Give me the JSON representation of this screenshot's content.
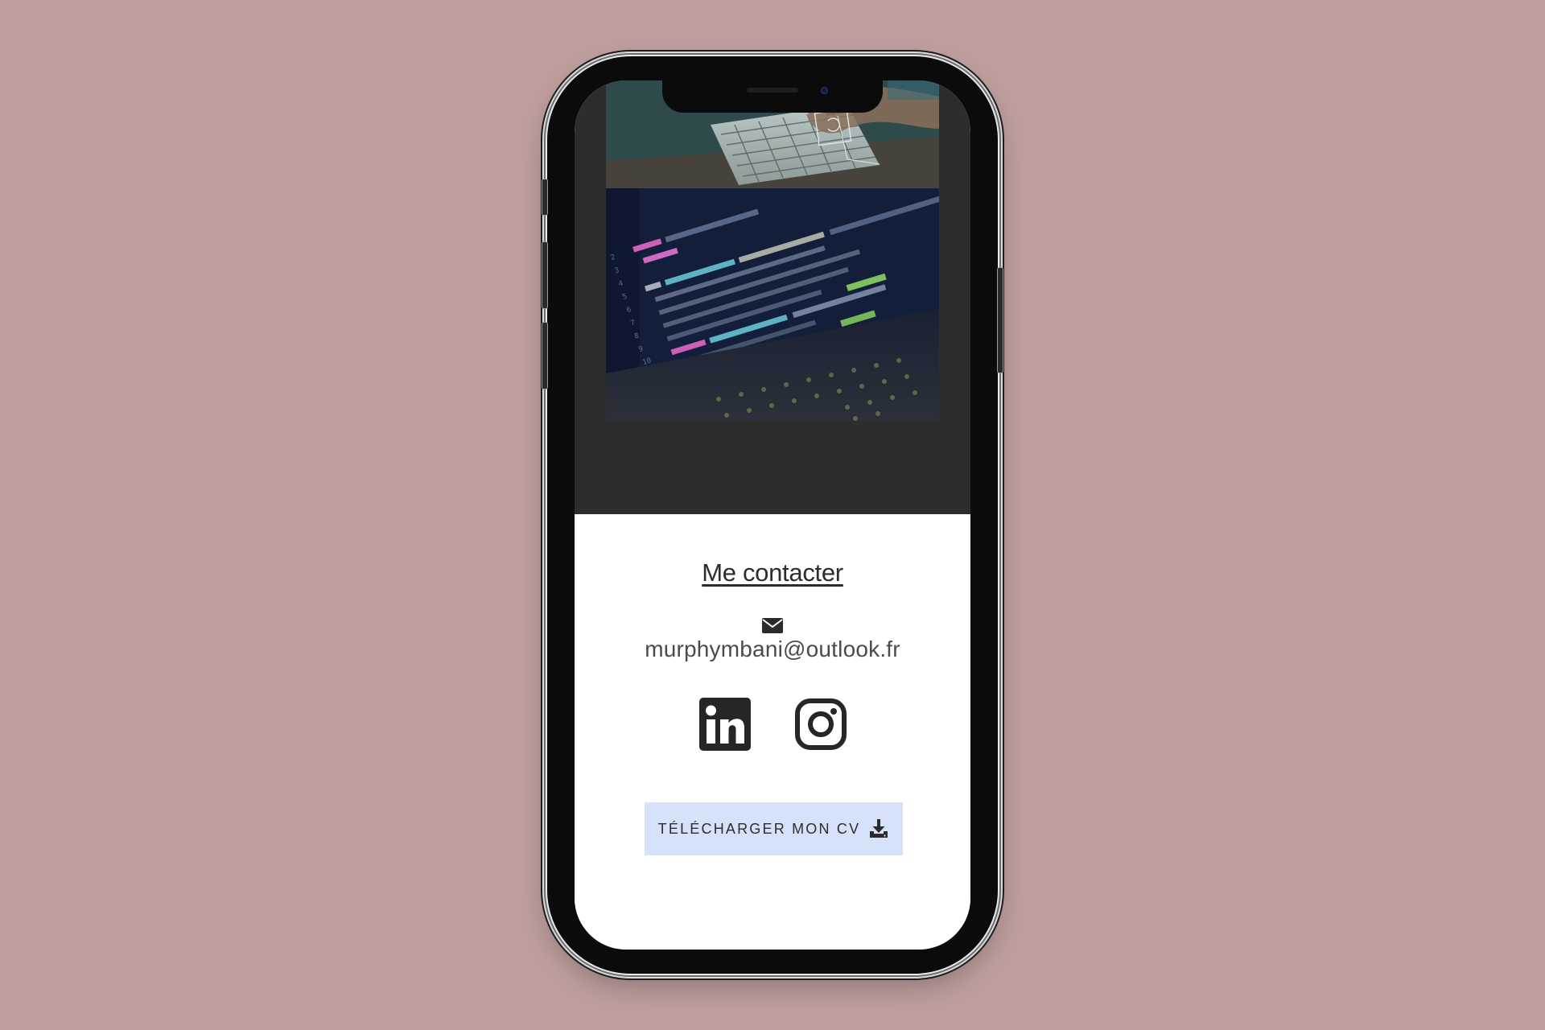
{
  "page": {
    "background_color": "#bf9f9e"
  },
  "contact": {
    "title": "Me contacter",
    "email": "murphymbani@outlook.fr",
    "mail_icon": "envelope-icon"
  },
  "social": {
    "items": [
      {
        "name": "LinkedIn",
        "icon": "linkedin-icon"
      },
      {
        "name": "Instagram",
        "icon": "instagram-icon"
      }
    ]
  },
  "cv_button": {
    "label": "TÉLÉCHARGER MON CV",
    "icon": "download-icon",
    "background": "#d6e1fa"
  },
  "theme": {
    "dark_section": "#2d2d2d",
    "light_section": "#ffffff",
    "text": "#2c2c2c"
  }
}
